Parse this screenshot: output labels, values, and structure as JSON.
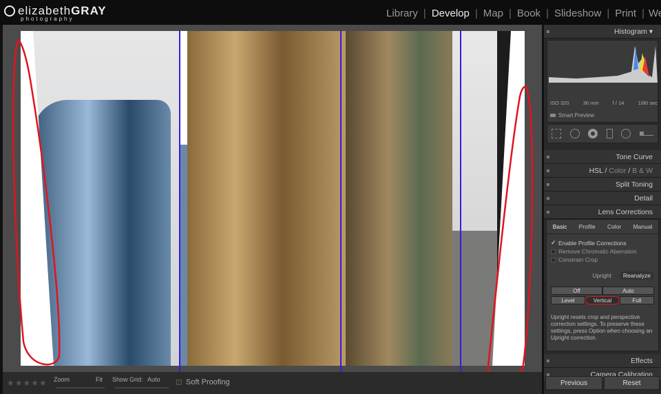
{
  "brand": {
    "name_light": "elizabeth",
    "name_bold": "GRAY",
    "tagline": "photography"
  },
  "modules": [
    "Library",
    "Develop",
    "Map",
    "Book",
    "Slideshow",
    "Print",
    "Web"
  ],
  "active_module": "Develop",
  "histogram": {
    "title": "Histogram",
    "iso": "ISO 320",
    "focal": "36 mm",
    "aperture": "f / 14",
    "shutter": "1/80 sec",
    "smart_preview": "Smart Preview"
  },
  "panels": {
    "tone_curve": "Tone Curve",
    "hsl": "HSL",
    "color": "Color",
    "bw": "B & W",
    "split_toning": "Split Toning",
    "detail": "Detail",
    "lens_corrections": "Lens Corrections",
    "effects": "Effects",
    "camera_calibration": "Camera Calibration"
  },
  "lens": {
    "tabs": [
      "Basic",
      "Profile",
      "Color",
      "Manual"
    ],
    "active_tab": "Basic",
    "checkboxes": [
      {
        "label": "Enable Profile Corrections",
        "checked": true
      },
      {
        "label": "Remove Chromatic Aberration",
        "checked": false
      },
      {
        "label": "Constrain Crop",
        "checked": false
      }
    ],
    "upright_label": "Upright",
    "reanalyze": "Reanalyze",
    "buttons_row1": [
      "Off",
      "Auto"
    ],
    "buttons_row2": [
      "Level",
      "Vertical",
      "Full"
    ],
    "selected": "Vertical",
    "note": "Upright resets crop and perspective correction settings. To preserve these settings, press Option when choosing an Upright correction."
  },
  "toolbar": {
    "rating": 0,
    "zoom_label": "Zoom",
    "zoom_value": "Fit",
    "grid_label": "Show Grid:",
    "grid_value": "Auto",
    "soft_proofing": "Soft Proofing"
  },
  "footer": {
    "previous": "Previous",
    "reset": "Reset"
  },
  "colors": {
    "guide_line": "#3a1ad8",
    "annotation": "#e0141e"
  }
}
